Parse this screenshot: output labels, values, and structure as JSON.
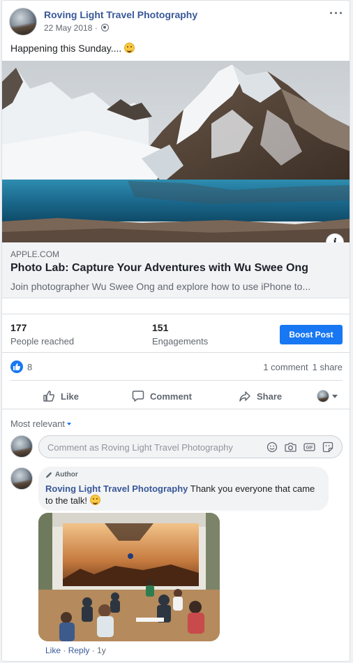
{
  "post": {
    "page_name": "Roving Light Travel Photography",
    "date": "22 May 2018 ·",
    "more_glyph": "···",
    "message": "Happening this Sunday.... "
  },
  "link": {
    "domain": "APPLE.COM",
    "title": "Photo Lab: Capture Your Adventures with Wu Swee Ong",
    "description": "Join photographer Wu Swee Ong and explore how to use iPhone to...",
    "info_glyph": "i"
  },
  "insights": {
    "reached_value": "177",
    "reached_label": "People reached",
    "engagements_value": "151",
    "engagements_label": "Engagements",
    "boost_label": "Boost Post"
  },
  "reactions": {
    "like_count": "8",
    "comments": "1 comment",
    "shares": "1 share"
  },
  "actions": {
    "like": "Like",
    "comment": "Comment",
    "share": "Share"
  },
  "comments": {
    "sort_label": "Most relevant",
    "input_placeholder": "Comment as Roving Light Travel Photography",
    "items": [
      {
        "badge": "Author",
        "name": "Roving Light Travel Photography",
        "text": " Thank you everyone that came to the talk! ",
        "like": "Like",
        "reply": "Reply",
        "time": "1y"
      }
    ]
  },
  "colors": {
    "accent": "#1877f2",
    "link": "#385898",
    "muted": "#606770"
  },
  "icons": [
    "globe-icon",
    "more-icon",
    "info-icon",
    "like-reaction-icon",
    "like-icon",
    "comment-icon",
    "share-icon",
    "emoji-icon",
    "camera-icon",
    "gif-icon",
    "sticker-icon",
    "edit-pencil-icon",
    "smiley-emoji"
  ]
}
